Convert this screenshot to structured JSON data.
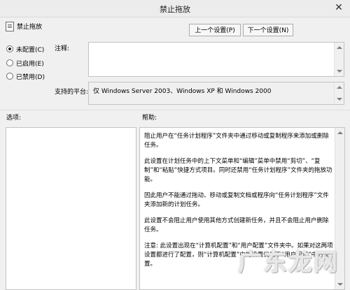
{
  "window": {
    "title": "禁止拖放",
    "close_glyph": "✕"
  },
  "header": {
    "policy_name": "禁止拖放"
  },
  "nav": {
    "prev_label": "上一个设置(P)",
    "next_label": "下一个设置(N)"
  },
  "state": {
    "options": [
      {
        "label": "未配置(C)",
        "checked": true
      },
      {
        "label": "已启用(E)",
        "checked": false
      },
      {
        "label": "已禁用(D)",
        "checked": false
      }
    ]
  },
  "comment": {
    "label": "注释:",
    "value": ""
  },
  "platform": {
    "label": "支持的平台:",
    "value": "仅 Windows Server 2003、Windows XP 和 Windows 2000"
  },
  "options_pane": {
    "label": "选项:"
  },
  "help_pane": {
    "label": "帮助:",
    "paragraphs": [
      "阻止用户在“任务计划程序”文件夹中通过移动或复制程序来添加或删除任务。",
      "此设置在计划任务中的上下文菜单和“编辑”菜单中禁用“剪切”、“复制”和“粘贴”快捷方式项目。同时还禁用“任务计划程序”文件夹的拖放功能。",
      "因此用户不能通过拖动、移动或复制文档或程序向“任务计划程序”文件夹添加新的计划任务。",
      "此设置不会阻止用户使用其他方式创建新任务，并且不会阻止用户删除任务。",
      "注意: 此设置出现在“计算机配置”和“用户配置”文件夹中。如果对这两项设置都进行了配置，则“计算机配置”中的设置优先于“用户配置”中的设置。"
    ]
  },
  "watermark": {
    "text": "广东龙网"
  }
}
